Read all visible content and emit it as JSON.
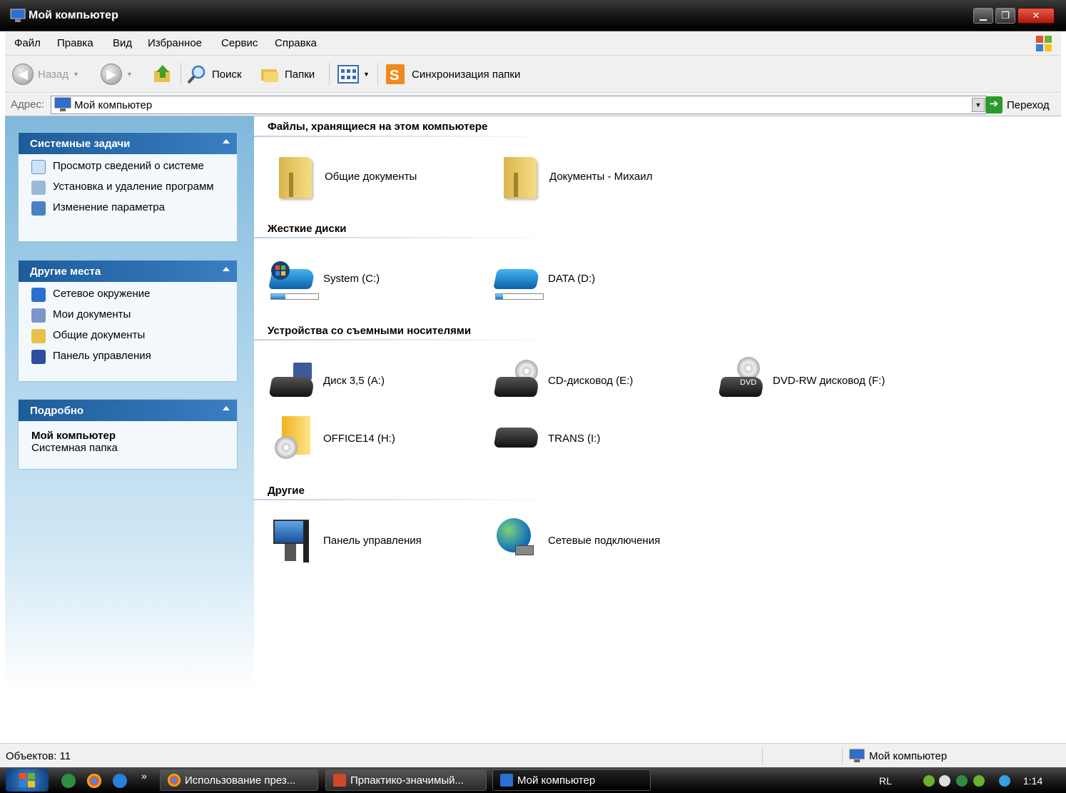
{
  "window": {
    "title": "Мой компьютер"
  },
  "menu": [
    "Файл",
    "Правка",
    "Вид",
    "Избранное",
    "Сервис",
    "Справка"
  ],
  "toolbar": {
    "back": "Назад",
    "search": "Поиск",
    "folders": "Папки",
    "sync": "Синхронизация папки"
  },
  "address": {
    "label": "Адрес:",
    "value": "Мой компьютер",
    "go": "Переход"
  },
  "sidebar": {
    "system_tasks": {
      "title": "Системные задачи",
      "items": [
        "Просмотр сведений о системе",
        "Установка и удаление программ",
        "Изменение параметра"
      ]
    },
    "other_places": {
      "title": "Другие места",
      "items": [
        "Сетевое окружение",
        "Мои документы",
        "Общие документы",
        "Панель управления"
      ]
    },
    "details": {
      "title": "Подробно",
      "name": "Мой компьютер",
      "desc": "Системная папка"
    }
  },
  "groups": {
    "files": {
      "title": "Файлы, хранящиеся на этом компьютере",
      "items": [
        "Общие документы",
        "Документы - Михаил"
      ]
    },
    "drives": {
      "title": "Жесткие диски",
      "items": [
        {
          "label": "System (C:)",
          "used": 0.3
        },
        {
          "label": "DATA (D:)",
          "used": 0.15
        }
      ]
    },
    "removable": {
      "title": "Устройства со съемными носителями",
      "items": [
        "Диск 3,5 (A:)",
        "CD-дисковод (E:)",
        "DVD-RW дисковод (F:)",
        "OFFICE14 (H:)",
        "TRANS (I:)"
      ]
    },
    "other": {
      "title": "Другие",
      "items": [
        "Панель управления",
        "Сетевые подключения"
      ]
    }
  },
  "icons": {
    "dvd_text": "DVD"
  },
  "status": {
    "left": "Объектов: 11",
    "right": "Мой компьютер"
  },
  "taskbar": {
    "tasks": [
      "Использование през...",
      "Прпактико-значимый...",
      "Мой компьютер"
    ],
    "lang": "RL",
    "time": "1:14",
    "more": "»"
  },
  "colors": {
    "sidebar_header": "#1d5c9a",
    "close_button": "#c8281a"
  }
}
